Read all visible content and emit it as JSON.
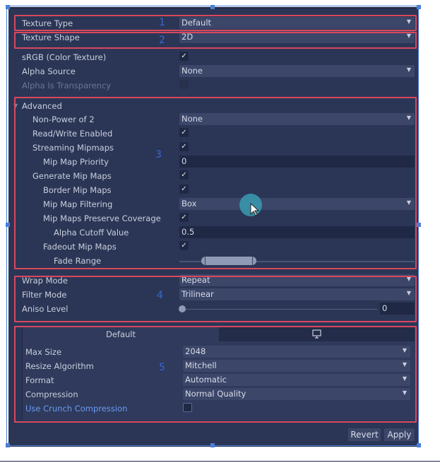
{
  "general": {
    "texture_type": {
      "label": "Texture Type",
      "value": "Default"
    },
    "texture_shape": {
      "label": "Texture Shape",
      "value": "2D"
    },
    "srgb": {
      "label": "sRGB (Color Texture)",
      "checked": true
    },
    "alpha_source": {
      "label": "Alpha Source",
      "value": "None"
    },
    "alpha_is_transparency": {
      "label": "Alpha Is Transparency",
      "checked": false,
      "disabled": true
    }
  },
  "advanced": {
    "label": "Advanced",
    "non_power_of_2": {
      "label": "Non-Power of 2",
      "value": "None"
    },
    "read_write": {
      "label": "Read/Write Enabled",
      "checked": true
    },
    "streaming_mipmaps": {
      "label": "Streaming Mipmaps",
      "checked": true
    },
    "mip_map_priority": {
      "label": "Mip Map Priority",
      "value": "0"
    },
    "generate_mip_maps": {
      "label": "Generate Mip Maps",
      "checked": true
    },
    "border_mip_maps": {
      "label": "Border Mip Maps",
      "checked": true
    },
    "mip_map_filtering": {
      "label": "Mip Map Filtering",
      "value": "Box"
    },
    "preserve_coverage": {
      "label": "Mip Maps Preserve Coverage",
      "checked": true
    },
    "alpha_cutoff": {
      "label": "Alpha Cutoff Value",
      "value": "0.5"
    },
    "fadeout_mip_maps": {
      "label": "Fadeout Mip Maps",
      "checked": true
    },
    "fade_range": {
      "label": "Fade Range"
    }
  },
  "sampling": {
    "wrap_mode": {
      "label": "Wrap Mode",
      "value": "Repeat"
    },
    "filter_mode": {
      "label": "Filter Mode",
      "value": "Trilinear"
    },
    "aniso_level": {
      "label": "Aniso Level",
      "value": "0"
    }
  },
  "platform": {
    "tabs": [
      {
        "label": "Default",
        "active": true
      },
      {
        "icon": "monitor-icon",
        "active": false
      }
    ],
    "max_size": {
      "label": "Max Size",
      "value": "2048"
    },
    "resize_algorithm": {
      "label": "Resize Algorithm",
      "value": "Mitchell"
    },
    "format": {
      "label": "Format",
      "value": "Automatic"
    },
    "compression": {
      "label": "Compression",
      "value": "Normal Quality"
    },
    "crunch": {
      "label": "Use Crunch Compression",
      "checked": false
    }
  },
  "annotations": [
    "1",
    "2",
    "3",
    "4",
    "5"
  ],
  "buttons": {
    "revert": "Revert",
    "apply": "Apply"
  },
  "colors": {
    "highlight_box": "#d9475e",
    "annotation": "#3a66d6",
    "cursor_highlight": "#3a9bb0"
  }
}
